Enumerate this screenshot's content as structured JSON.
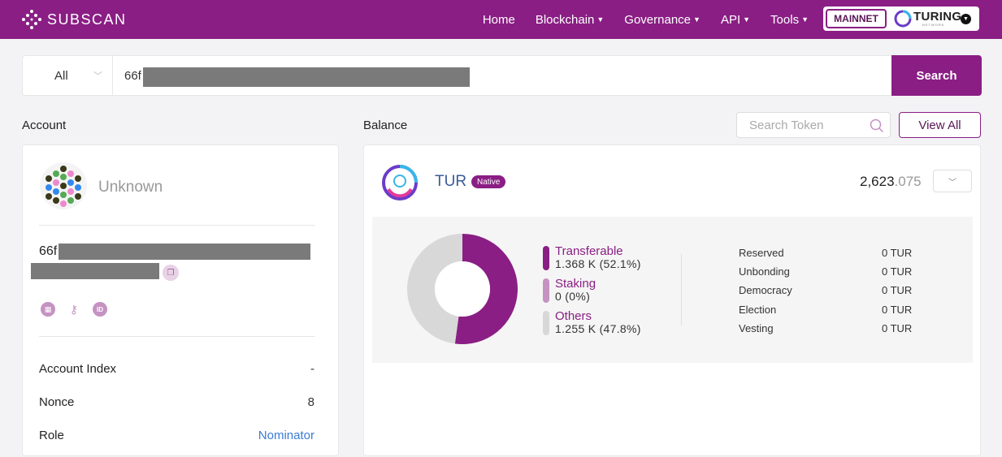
{
  "header": {
    "logo_text": "SUBSCAN",
    "nav": [
      {
        "label": "Home",
        "dropdown": false
      },
      {
        "label": "Blockchain",
        "dropdown": true
      },
      {
        "label": "Governance",
        "dropdown": true
      },
      {
        "label": "API",
        "dropdown": true
      },
      {
        "label": "Tools",
        "dropdown": true
      }
    ],
    "network_badge": "MAINNET",
    "network_name": "TURING",
    "network_sub": "NETWORK"
  },
  "search": {
    "type": "All",
    "value_prefix": "66f",
    "button": "Search"
  },
  "account": {
    "section_title": "Account",
    "display_name": "Unknown",
    "address_prefix": "66f",
    "rows": [
      {
        "label": "Account Index",
        "value": "-"
      },
      {
        "label": "Nonce",
        "value": "8"
      },
      {
        "label": "Role",
        "value": "Nominator"
      }
    ]
  },
  "balance": {
    "section_title": "Balance",
    "search_placeholder": "Search Token",
    "view_all": "View All",
    "token": {
      "symbol": "TUR",
      "badge": "Native",
      "amount_int": "2,623",
      "amount_dec": ".075"
    },
    "breakdown": [
      {
        "label": "Transferable",
        "value": "1.368 K",
        "percent_text": "(52.1%)",
        "share": 0.521,
        "color": "#8a1e84"
      },
      {
        "label": "Staking",
        "value": "0",
        "percent_text": "(0%)",
        "share": 0,
        "color": "#c592c2"
      },
      {
        "label": "Others",
        "value": "1.255 K",
        "percent_text": "(47.8%)",
        "share": 0.478,
        "color": "#d8d8d8"
      }
    ],
    "locks": [
      {
        "label": "Reserved",
        "value": "0 TUR"
      },
      {
        "label": "Unbonding",
        "value": "0 TUR"
      },
      {
        "label": "Democracy",
        "value": "0 TUR"
      },
      {
        "label": "Election",
        "value": "0 TUR"
      },
      {
        "label": "Vesting",
        "value": "0 TUR"
      }
    ]
  }
}
